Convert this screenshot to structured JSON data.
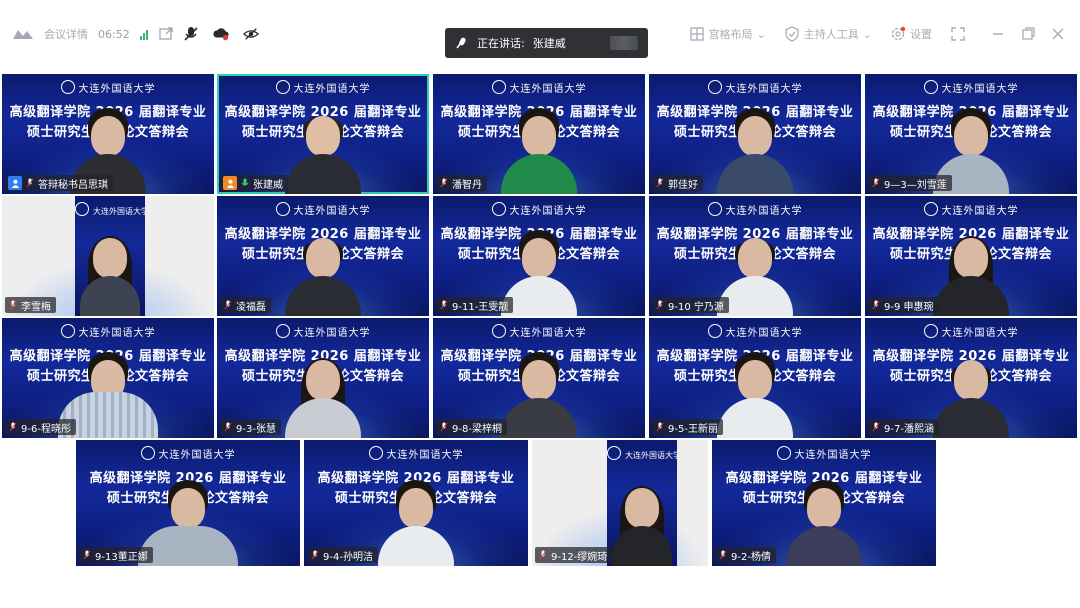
{
  "toolbar": {
    "meeting_details_label": "会议详情",
    "elapsed_time": "06:52",
    "speaking_label": "正在讲话:",
    "speaking_name": "张建威",
    "layout_label": "宫格布局",
    "host_tools_label": "主持人工具",
    "settings_label": "设置"
  },
  "banner": {
    "university": "大连外国语大学",
    "line1": "高级翻译学院 2026 届翻译专业",
    "line2": "硕士研究生毕业论文答辩会"
  },
  "participants": [
    {
      "name": "答辩秘书吕思琪"
    },
    {
      "name": "张建威"
    },
    {
      "name": "潘智丹"
    },
    {
      "name": "郭佳好"
    },
    {
      "name": "9—3—刘雪莲"
    },
    {
      "name": "李雪梅"
    },
    {
      "name": "凌福磊"
    },
    {
      "name": "9-11-王雯靓"
    },
    {
      "name": "9-10 宁乃源"
    },
    {
      "name": "9-9 申惠琬"
    },
    {
      "name": "9-6-程晓彤"
    },
    {
      "name": "9-3-张慧"
    },
    {
      "name": "9-8-梁梓桐"
    },
    {
      "name": "9-5-王新丽"
    },
    {
      "name": "9-7-潘熙涵"
    },
    {
      "name": "9-13董正娜"
    },
    {
      "name": "9-4-孙明洁"
    },
    {
      "name": "9-12-缪婉琦"
    },
    {
      "name": "9-2-杨倩"
    }
  ]
}
